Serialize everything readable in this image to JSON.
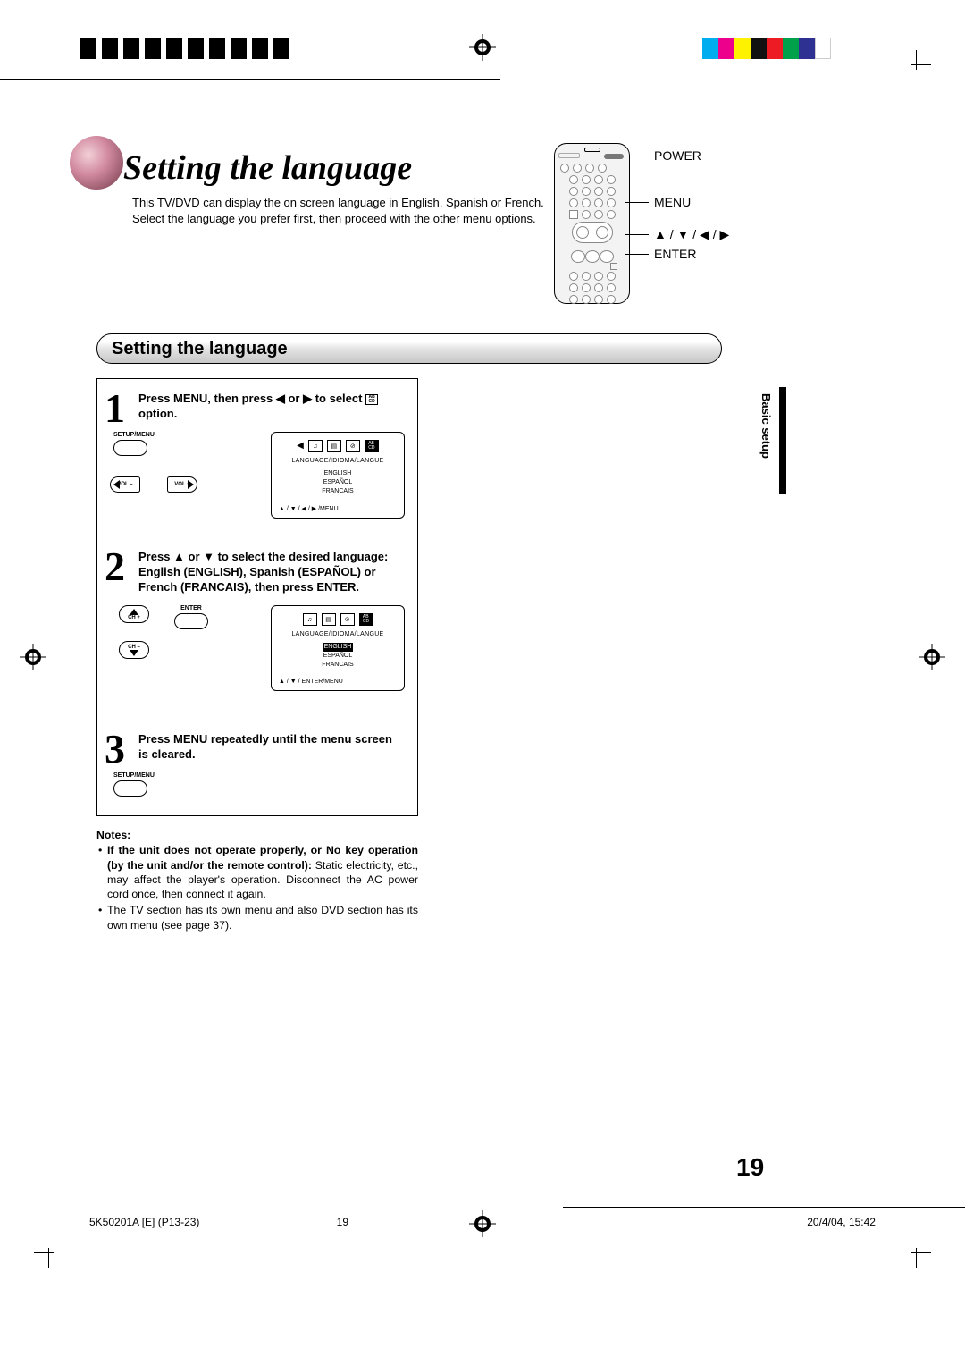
{
  "heading": "Setting the language",
  "intro": "This TV/DVD can display the on screen language in English, Spanish or French. Select the language you prefer first, then proceed with the other menu options.",
  "remote_labels": {
    "power": "POWER",
    "menu": "MENU",
    "nav": "▲ / ▼ / ◀ / ▶",
    "enter": "ENTER"
  },
  "section_title": "Setting the language",
  "side_tab": "Basic setup",
  "steps": [
    {
      "num": "1",
      "text_a": "Press MENU, then press ◀ or ▶ to select ",
      "text_b": " option.",
      "btn_label": "SETUP/MENU",
      "vol_minus": "VOL –",
      "vol_plus": "VOL +",
      "osd": {
        "subtitle": "LANGUAGE/IDIOMA/LANGUE",
        "opts": [
          "ENGLISH",
          "ESPAÑOL",
          "FRANCAIS"
        ],
        "footer": "▲ / ▼ / ◀ / ▶ /MENU",
        "selected_icon": 4
      }
    },
    {
      "num": "2",
      "text": "Press ▲ or ▼ to select the desired language: English (ENGLISH), Spanish (ESPAÑOL) or French (FRANCAIS), then press ENTER.",
      "enter": "ENTER",
      "ch_plus": "CH +",
      "ch_minus": "CH –",
      "osd": {
        "subtitle": "LANGUAGE/IDIOMA/LANGUE",
        "opts": [
          "ENGLISH",
          "ESPAÑOL",
          "FRANCAIS"
        ],
        "selected_opt": 0,
        "footer": "▲ / ▼ / ENTER/MENU"
      }
    },
    {
      "num": "3",
      "text": "Press MENU repeatedly until the menu screen is cleared.",
      "btn_label": "SETUP/MENU"
    }
  ],
  "notes_heading": "Notes:",
  "notes": [
    {
      "bold": "If the unit does not operate properly, or No key operation (by the unit and/or the remote control): ",
      "rest": "Static electricity, etc., may affect the player's operation. Disconnect the AC power cord once, then connect it again."
    },
    {
      "bold": "",
      "rest": "The TV section has its own menu and also DVD section has its own menu (see page 37)."
    }
  ],
  "page_number": "19",
  "footer": {
    "left": "5K50201A [E] (P13-23)",
    "mid": "19",
    "right": "20/4/04, 15:42"
  },
  "colors": {
    "cyan": "#00adee",
    "magenta": "#ec008c",
    "yellow": "#fff200",
    "red": "#ed1c24",
    "green": "#00a14b",
    "blue": "#2e3192",
    "black": "#111"
  },
  "icon_glyph": "AB CD"
}
